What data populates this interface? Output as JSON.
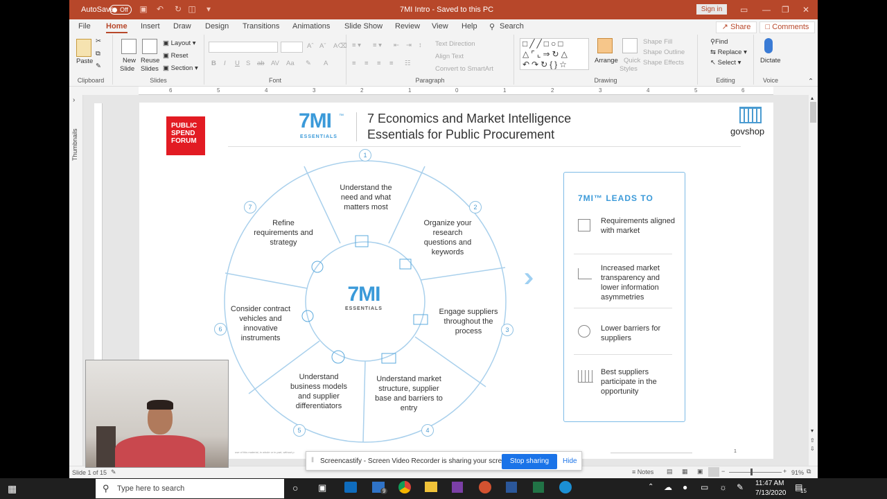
{
  "titlebar": {
    "autosave_label": "AutoSave",
    "autosave_state": "Off",
    "doc_title": "7MI Intro  -  Saved to this PC",
    "signin_label": "Sign in"
  },
  "tabs": [
    "File",
    "Home",
    "Insert",
    "Draw",
    "Design",
    "Transitions",
    "Animations",
    "Slide Show",
    "Review",
    "View",
    "Help"
  ],
  "active_tab": "Home",
  "search_label": "Search",
  "share_label": "Share",
  "comments_label": "Comments",
  "ribbon": {
    "clipboard": {
      "label": "Clipboard",
      "paste": "Paste"
    },
    "slides": {
      "label": "Slides",
      "new_slide": "New",
      "new_slide2": "Slide",
      "reuse": "Reuse",
      "reuse2": "Slides",
      "layout": "Layout",
      "reset": "Reset",
      "section": "Section"
    },
    "font": {
      "label": "Font"
    },
    "paragraph": {
      "label": "Paragraph",
      "text_direction": "Text Direction",
      "align_text": "Align Text",
      "convert": "Convert to SmartArt"
    },
    "drawing": {
      "label": "Drawing",
      "arrange": "Arrange",
      "quick_styles": "Quick",
      "quick_styles2": "Styles",
      "shape_fill": "Shape Fill",
      "shape_outline": "Shape Outline",
      "shape_effects": "Shape Effects"
    },
    "editing": {
      "label": "Editing",
      "find": "Find",
      "replace": "Replace",
      "select": "Select"
    },
    "voice": {
      "label": "Voice",
      "dictate": "Dictate"
    }
  },
  "thumbnails_label": "Thumbnails",
  "slide": {
    "brand_logo": "PUBLIC SPEND FORUM",
    "brand_logo_lines": [
      "PUBLIC",
      "SPEND",
      "FORUM"
    ],
    "mark": "7MI",
    "tm": "™",
    "mark_sub": "ESSENTIALS",
    "title_line1": "7 Economics and Market Intelligence",
    "title_line2": "Essentials for Public Procurement",
    "govshop": "govshop",
    "center_mark": "7MI",
    "center_sub": "ESSENTIALS",
    "segments": [
      {
        "num": "1",
        "text": "Understand the need and what matters most"
      },
      {
        "num": "2",
        "text": "Organize your research questions and keywords"
      },
      {
        "num": "3",
        "text": "Engage suppliers throughout the process"
      },
      {
        "num": "4",
        "text": "Understand market structure, supplier base and barriers to entry"
      },
      {
        "num": "5",
        "text": "Understand business models and supplier differentiators"
      },
      {
        "num": "6",
        "text": "Consider contract vehicles and innovative instruments"
      },
      {
        "num": "7",
        "text": "Refine requirements and strategy"
      }
    ],
    "leads_title": "7MI™ LEADS TO",
    "leads": [
      "Requirements aligned with market",
      "Increased market transparency and lower information asymmetries",
      "Lower barriers for suppliers",
      "Best suppliers participate in the opportunity"
    ],
    "footnote": "use of this material, in whole or in part, without p",
    "page_num": "1"
  },
  "share_bar": {
    "message": "Screencastify - Screen Video Recorder is sharing your screen.",
    "stop_label": "Stop sharing",
    "hide_label": "Hide"
  },
  "status": {
    "slide_info": "Slide 1 of 15",
    "notes_label": "Notes",
    "zoom": "91%"
  },
  "taskbar": {
    "search_placeholder": "Type here to search",
    "time": "11:47 AM",
    "date": "7/13/2020",
    "mail_badge": "9",
    "notif_badge": "15"
  }
}
